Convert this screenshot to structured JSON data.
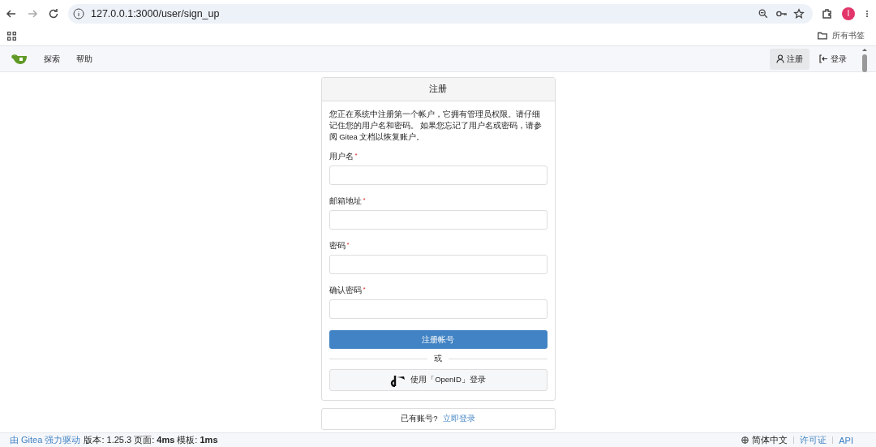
{
  "browser": {
    "url": "127.0.0.1:3000/user/sign_up",
    "profile_initial": "I",
    "bookmarks_folder": "所有书签"
  },
  "nav": {
    "links": [
      "探索",
      "帮助"
    ],
    "actions": [
      {
        "kind": "register",
        "label": "注册",
        "selected": true
      },
      {
        "kind": "login",
        "label": "登录",
        "selected": false
      }
    ]
  },
  "signup": {
    "title": "注册",
    "notice": "您正在系统中注册第一个帐户，它拥有管理员权限。请仔细记住您的用户名和密码。 如果您忘记了用户名或密码，请参阅 Gitea 文档以恢复账户。",
    "fields": [
      {
        "label": "用户名",
        "required_mark": "*"
      },
      {
        "label": "邮箱地址",
        "required_mark": "*"
      },
      {
        "label": "密码",
        "required_mark": "*"
      },
      {
        "label": "确认密码",
        "required_mark": "*"
      }
    ],
    "submit": "注册帐号",
    "divider": "或",
    "openid": "使用「OpenID」登录",
    "has_account": "已有账号?",
    "login_link": "立即登录"
  },
  "footer": {
    "powered": "由 Gitea 强力驱动",
    "version": "版本: 1.25.3 页面: **4ms** 模板: **1ms**",
    "language": "简体中文",
    "links": [
      "许可证",
      "API"
    ]
  }
}
